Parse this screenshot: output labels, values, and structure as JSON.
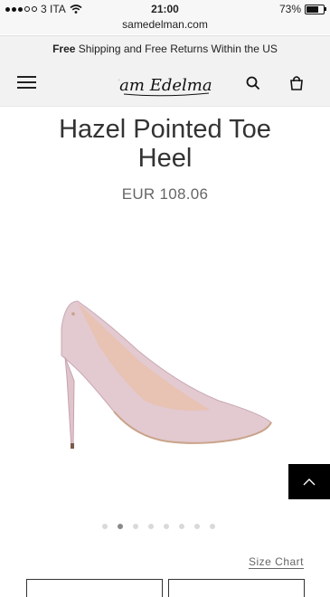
{
  "status_bar": {
    "carrier": "3 ITA",
    "time": "21:00",
    "battery_percent": "73%",
    "battery_level": 0.73,
    "signal_bars_filled": 3,
    "signal_bars_total": 5
  },
  "browser": {
    "url": "samedelman.com"
  },
  "promo": {
    "bold": "Free",
    "rest": " Shipping and Free Returns Within the US"
  },
  "header": {
    "logo_text": "Sam Edelman"
  },
  "product": {
    "title_line1": "Hazel Pointed Toe",
    "title_line2": "Heel",
    "price": "EUR 108.06",
    "shoe_color": "#e3c9d0",
    "image_count": 8,
    "active_image_index": 1
  },
  "links": {
    "size_chart": "Size Chart"
  }
}
